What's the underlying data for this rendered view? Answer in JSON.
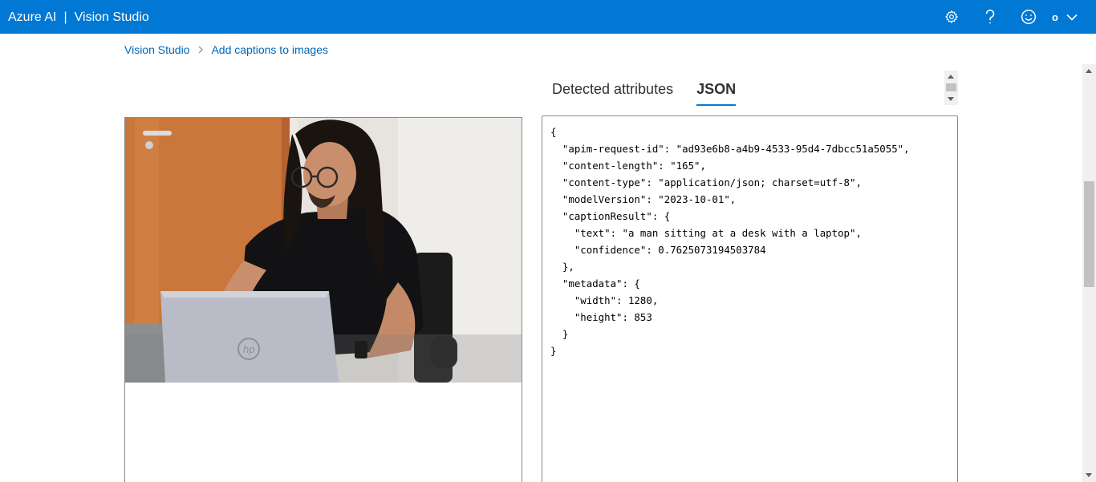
{
  "header": {
    "brand": "Azure AI",
    "separator": "|",
    "product": "Vision Studio",
    "account_initial": "o",
    "icons": [
      "gear-icon",
      "help-icon",
      "smiley-icon",
      "chevron-down-icon"
    ]
  },
  "breadcrumb": {
    "items": [
      "Vision Studio",
      "Add captions to images"
    ]
  },
  "tabs": [
    {
      "label": "Detected attributes",
      "active": false
    },
    {
      "label": "JSON",
      "active": true
    }
  ],
  "json_lines": [
    "{",
    "  \"apim-request-id\": \"ad93e6b8-a4b9-4533-95d4-7dbcc51a5055\",",
    "  \"content-length\": \"165\",",
    "  \"content-type\": \"application/json; charset=utf-8\",",
    "  \"modelVersion\": \"2023-10-01\",",
    "  \"captionResult\": {",
    "    \"text\": \"a man sitting at a desk with a laptop\",",
    "    \"confidence\": 0.7625073194503784",
    "  },",
    "  \"metadata\": {",
    "    \"width\": 1280,",
    "    \"height\": 853",
    "  }",
    "}"
  ],
  "colors": {
    "accent": "#0078d4",
    "link": "#0067b8"
  }
}
